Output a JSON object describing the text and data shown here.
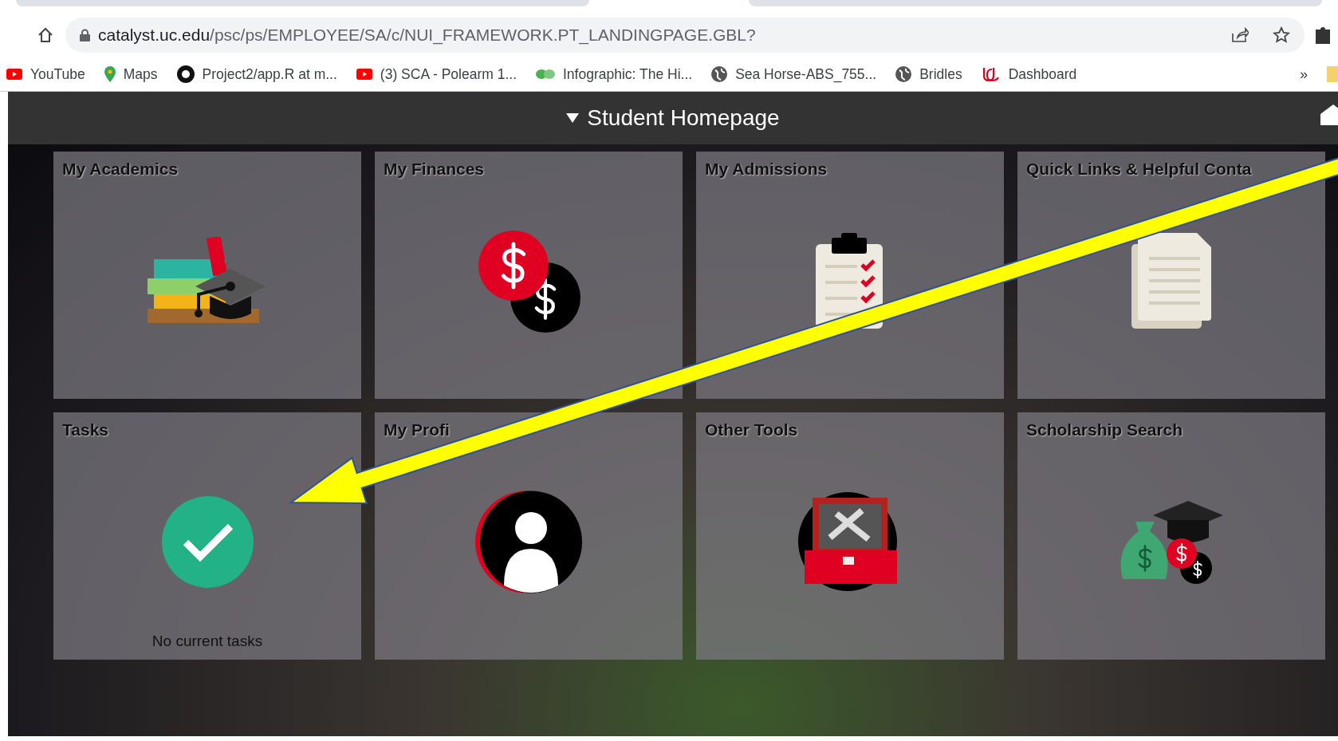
{
  "address_bar": {
    "host": "catalyst.uc.edu",
    "path": "/psc/ps/EMPLOYEE/SA/c/NUI_FRAMEWORK.PT_LANDINGPAGE.GBL?"
  },
  "bookmarks": [
    {
      "label": "YouTube"
    },
    {
      "label": "Maps"
    },
    {
      "label": "Project2/app.R at m..."
    },
    {
      "label": "(3) SCA - Polearm 1..."
    },
    {
      "label": "Infographic: The Hi..."
    },
    {
      "label": "Sea Horse-ABS_755..."
    },
    {
      "label": "Bridles"
    },
    {
      "label": "Dashboard"
    }
  ],
  "bookmarks_overflow": "»",
  "header": {
    "title": "Student Homepage"
  },
  "tiles": [
    {
      "title": "My Academics"
    },
    {
      "title": "My Finances"
    },
    {
      "title": "My Admissions"
    },
    {
      "title": "Quick Links & Helpful Conta"
    },
    {
      "title": "Tasks",
      "message": "No current tasks"
    },
    {
      "title": "My Profi"
    },
    {
      "title": "Other Tools"
    },
    {
      "title": "Scholarship Search"
    }
  ]
}
